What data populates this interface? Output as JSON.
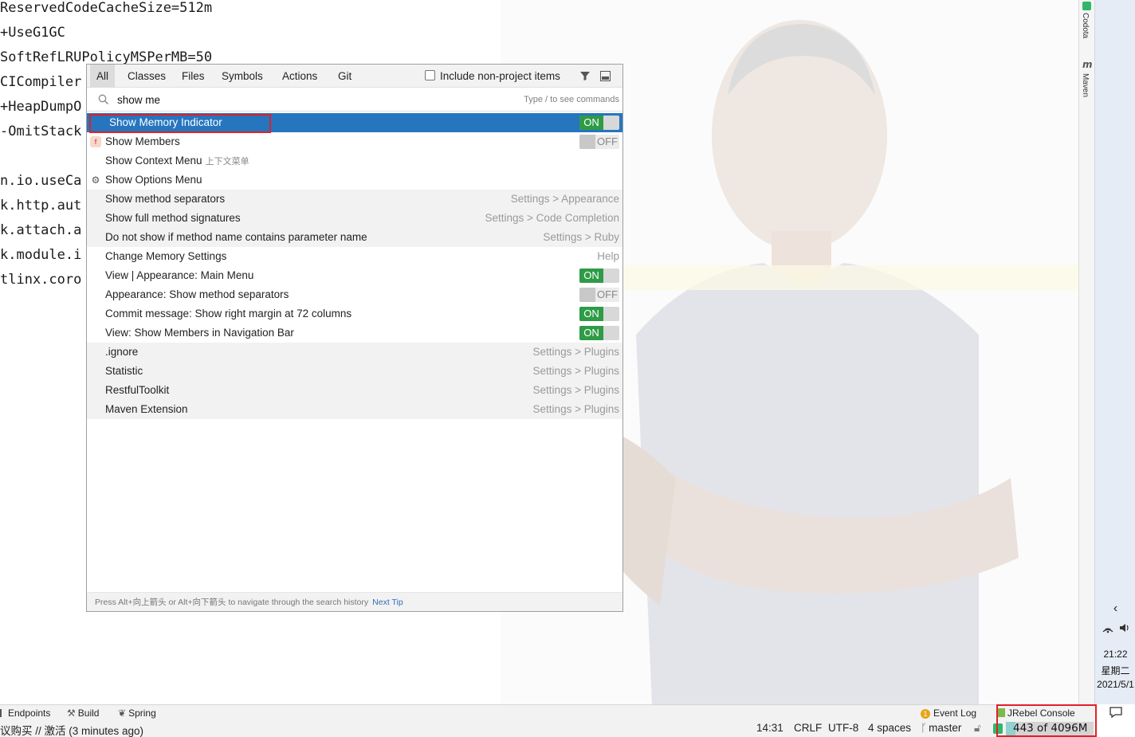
{
  "editor": {
    "lines": [
      "ReservedCodeCacheSize=512m",
      "+UseG1GC",
      "SoftRefLRUPolicyMSPerMB=50",
      "CICompiler",
      "+HeapDumpO",
      "-OmitStack",
      "",
      "n.io.useCa",
      "k.http.aut",
      "k.attach.a",
      "k.module.i",
      "tlinx.coro"
    ]
  },
  "popup": {
    "tabs": [
      "All",
      "Classes",
      "Files",
      "Symbols",
      "Actions",
      "Git"
    ],
    "active_tab": "All",
    "include_non_project_label": "Include non-project items",
    "filter_icon": "filter-icon",
    "preview_icon": "preview-panel-icon",
    "search_icon": "search-icon",
    "search_value": "show me",
    "search_hint": "Type / to see commands",
    "results": [
      {
        "label": "Show Memory Indicator",
        "sub": "",
        "location": "",
        "toggle": "ON",
        "selected": true,
        "shaded": false,
        "icon": ""
      },
      {
        "label": "Show Members",
        "sub": "",
        "location": "",
        "toggle": "OFF",
        "selected": false,
        "shaded": false,
        "icon": "members-icon"
      },
      {
        "label": "Show Context Menu",
        "sub": "上下文菜单",
        "location": "",
        "toggle": "",
        "selected": false,
        "shaded": false,
        "icon": ""
      },
      {
        "label": "Show Options Menu",
        "sub": "",
        "location": "",
        "toggle": "",
        "selected": false,
        "shaded": false,
        "icon": "gear-icon"
      },
      {
        "label": "Show method separators",
        "sub": "",
        "location": "Settings > Appearance",
        "toggle": "",
        "selected": false,
        "shaded": true,
        "icon": ""
      },
      {
        "label": "Show full method signatures",
        "sub": "",
        "location": "Settings > Code Completion",
        "toggle": "",
        "selected": false,
        "shaded": true,
        "icon": ""
      },
      {
        "label": "Do not show if method name contains parameter name",
        "sub": "",
        "location": "Settings > Ruby",
        "toggle": "",
        "selected": false,
        "shaded": true,
        "icon": ""
      },
      {
        "label": "Change Memory Settings",
        "sub": "",
        "location": "Help",
        "toggle": "",
        "selected": false,
        "shaded": false,
        "icon": ""
      },
      {
        "label": "View | Appearance: Main Menu",
        "sub": "",
        "location": "",
        "toggle": "ON",
        "selected": false,
        "shaded": false,
        "icon": ""
      },
      {
        "label": "Appearance: Show method separators",
        "sub": "",
        "location": "",
        "toggle": "OFF",
        "selected": false,
        "shaded": false,
        "icon": ""
      },
      {
        "label": "Commit message: Show right margin at 72 columns",
        "sub": "",
        "location": "",
        "toggle": "ON",
        "selected": false,
        "shaded": false,
        "icon": ""
      },
      {
        "label": "View: Show Members in Navigation Bar",
        "sub": "",
        "location": "",
        "toggle": "ON",
        "selected": false,
        "shaded": false,
        "icon": ""
      },
      {
        "label": ".ignore",
        "sub": "",
        "location": "Settings > Plugins",
        "toggle": "",
        "selected": false,
        "shaded": true,
        "icon": ""
      },
      {
        "label": "Statistic",
        "sub": "",
        "location": "Settings > Plugins",
        "toggle": "",
        "selected": false,
        "shaded": true,
        "icon": ""
      },
      {
        "label": "RestfulToolkit",
        "sub": "",
        "location": "Settings > Plugins",
        "toggle": "",
        "selected": false,
        "shaded": true,
        "icon": ""
      },
      {
        "label": "Maven Extension",
        "sub": "",
        "location": "Settings > Plugins",
        "toggle": "",
        "selected": false,
        "shaded": true,
        "icon": ""
      }
    ],
    "footer_tip": "Press Alt+向上箭头 or Alt+向下箭头 to navigate through the search history",
    "footer_next_tip": "Next Tip"
  },
  "right_strip": {
    "codota": "Codota",
    "maven": "Maven"
  },
  "tool_windows": {
    "endpoints": "Endpoints",
    "build": "Build",
    "spring": "Spring",
    "event_log": "Event Log",
    "event_log_count": "1",
    "jrebel_console": "JRebel Console"
  },
  "status_bar": {
    "message": "议购买 // 激活 (3 minutes ago)",
    "position": "14:31",
    "line_sep": "CRLF",
    "encoding": "UTF-8",
    "indent": "4 spaces",
    "branch": "master",
    "memory": "443 of 4096M",
    "memory_used_fraction": 0.108
  },
  "taskbar": {
    "time": "21:22",
    "weekday": "星期二",
    "date": "2021/5/1"
  },
  "colors": {
    "selection": "#2675bf",
    "toggle_on": "#2e9b46",
    "highlight_box": "#e0202a"
  }
}
